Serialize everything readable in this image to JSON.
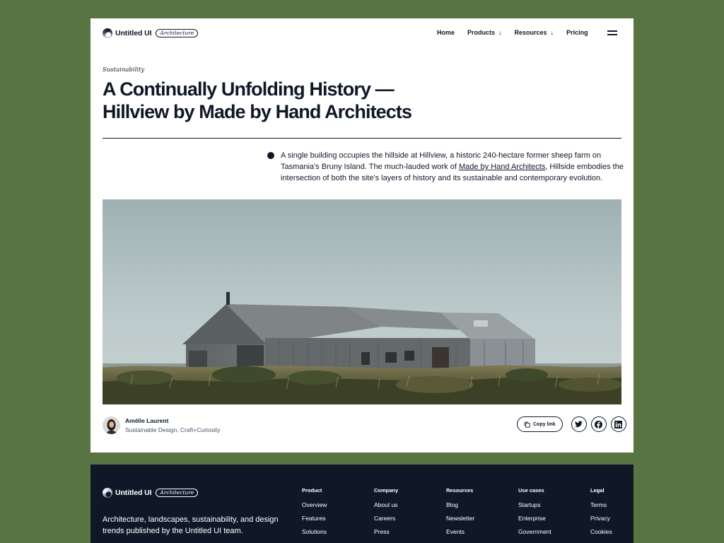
{
  "brand": {
    "name": "Untitled UI",
    "tag": "Architecture"
  },
  "nav": {
    "items": [
      {
        "label": "Home",
        "has_dropdown": false
      },
      {
        "label": "Products",
        "has_dropdown": true
      },
      {
        "label": "Resources",
        "has_dropdown": true
      },
      {
        "label": "Pricing",
        "has_dropdown": false
      }
    ],
    "menu_icon": "hamburger-menu-icon"
  },
  "article": {
    "category": "Sustainability",
    "title": "A Continually Unfolding History — Hillview by Made by Hand Architects",
    "lead_before": "A single building occupies the hillside at Hillview, a historic 240-hectare former sheep farm on Tasmania's Bruny Island. The much-lauded work of ",
    "lead_link": "Made by Hand Architects",
    "lead_after": ", Hillside embodies the intersection of both the site's layers of history and its sustainable and contemporary evolution.",
    "hero_alt": "Timber-clad farmhouse on a grassy hillside under an overcast sky"
  },
  "author": {
    "name": "Amélie Laurent",
    "role": "Sustainable Design, Craft+Curiosity"
  },
  "share": {
    "copy_label": "Copy link",
    "icons": [
      "twitter-icon",
      "facebook-icon",
      "linkedin-icon"
    ]
  },
  "footer": {
    "blurb": "Architecture, landscapes, sustainability, and design trends published by the Untitled UI team.",
    "columns": [
      {
        "title": "Product",
        "links": [
          "Overview",
          "Features",
          "Solutions"
        ]
      },
      {
        "title": "Company",
        "links": [
          "About us",
          "Careers",
          "Press"
        ]
      },
      {
        "title": "Resources",
        "links": [
          "Blog",
          "Newsletter",
          "Events"
        ]
      },
      {
        "title": "Use cases",
        "links": [
          "Startups",
          "Enterprise",
          "Government"
        ]
      },
      {
        "title": "Legal",
        "links": [
          "Terms",
          "Privacy",
          "Cookies"
        ]
      }
    ]
  },
  "colors": {
    "background": "#577442",
    "text": "#101828",
    "footer": "#101828",
    "card": "#ffffff"
  }
}
